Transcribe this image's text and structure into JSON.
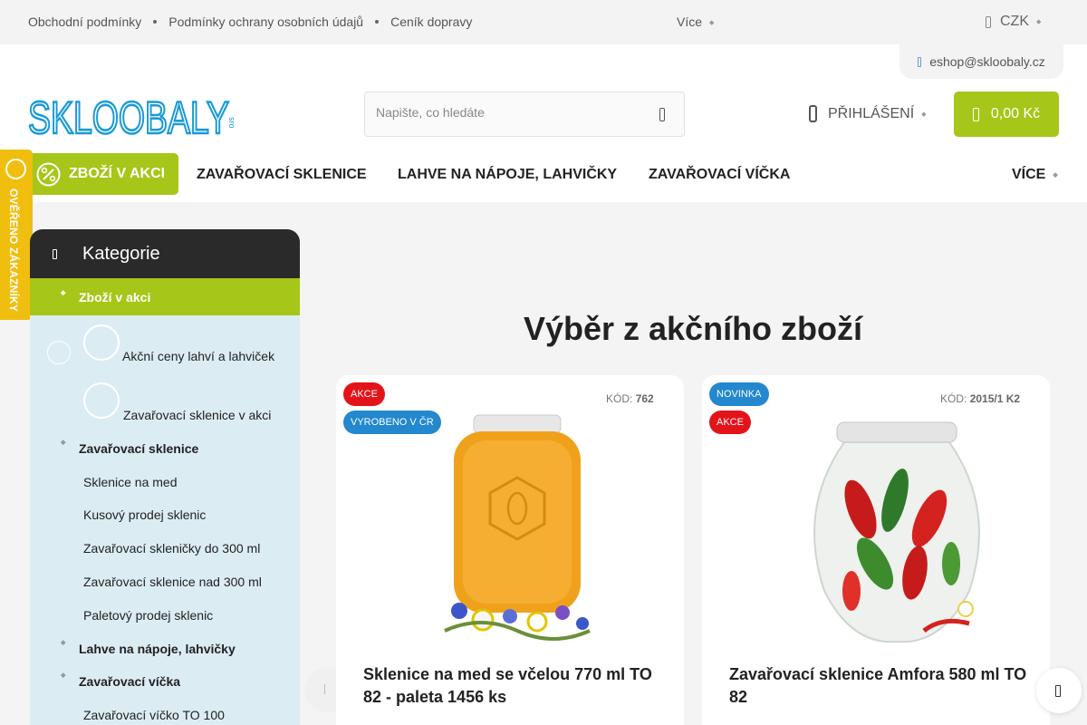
{
  "topbar": {
    "links": [
      "Obchodní podmínky",
      "Podmínky ochrany osobních údajů",
      "Ceník dopravy"
    ],
    "more_label": "Více",
    "currency": "CZK",
    "email": "eshop@skloobaly.cz"
  },
  "header": {
    "logo_text": "SKLOOBALY",
    "logo_suffix": "sro",
    "search_placeholder": "Napište, co hledáte",
    "login_label": "PŘIHLÁŠENÍ",
    "cart_total": "0,00 Kč"
  },
  "nav": {
    "items": [
      "ZBOŽÍ V AKCI",
      "ZAVAŘOVACÍ SKLENICE",
      "LAHVE NA NÁPOJE, LAHVIČKY",
      "ZAVAŘOVACÍ VÍČKA"
    ],
    "more_label": "VÍCE"
  },
  "verified_label": "OVĚŘENO ZÁKAZNÍKY",
  "sidebar": {
    "title": "Kategorie",
    "active_category": "Zboží v akci",
    "akce_subitems": [
      "Akční ceny lahví a lahviček",
      "Zavařovací sklenice v akci"
    ],
    "categories": [
      {
        "label": "Zavařovací sklenice",
        "children": [
          "Sklenice na med",
          "Kusový prodej sklenic",
          "Zavařovací skleničky do 300 ml",
          "Zavařovací sklenice nad 300 ml",
          "Paletový prodej sklenic"
        ]
      },
      {
        "label": "Lahve na nápoje, lahvičky",
        "children": []
      },
      {
        "label": "Zavařovací víčka",
        "children": [
          "Zavařovací víčko TO 100"
        ]
      }
    ]
  },
  "main": {
    "title": "Výběr z akčního zboží",
    "products": [
      {
        "badges": [
          "AKCE",
          "VYROBENO V ČR"
        ],
        "code_label": "KÓD:",
        "code": "762",
        "name": "Sklenice na med se včelou 770 ml TO 82 - paleta 1456 ks"
      },
      {
        "badges": [
          "NOVINKA",
          "AKCE"
        ],
        "code_label": "KÓD:",
        "code": "2015/1 K2",
        "name": "Zavařovací sklenice Amfora 580 ml TO 82"
      }
    ]
  },
  "colors": {
    "accent_green": "#a6c619",
    "badge_red": "#e2141a",
    "badge_blue": "#2388ce",
    "verified_yellow": "#f0be0e",
    "sidebar_bg": "#dcecf3",
    "logo_blue": "#1a9ad6"
  }
}
